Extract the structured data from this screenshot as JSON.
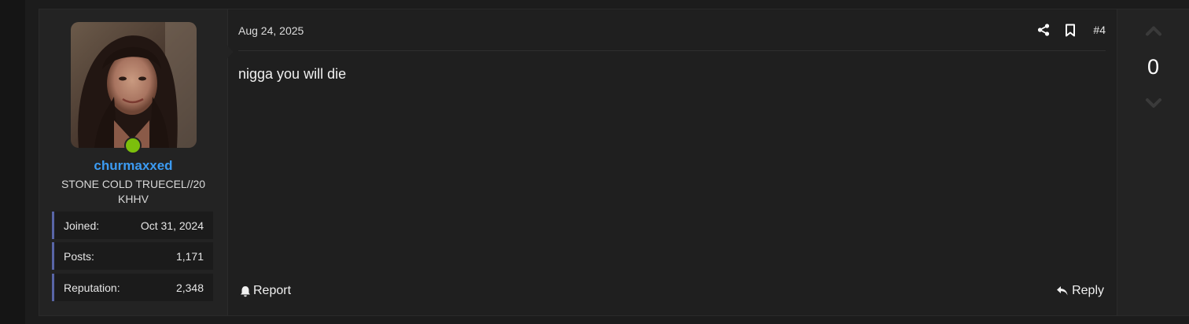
{
  "user": {
    "username": "churmaxxed",
    "title": "STONE COLD TRUECEL//20 KHHV",
    "status_color": "#7cbf0c",
    "username_color": "#3c9bf2",
    "stats": [
      {
        "label": "Joined:",
        "value": "Oct 31, 2024"
      },
      {
        "label": "Posts:",
        "value": "1,171"
      },
      {
        "label": "Reputation:",
        "value": "2,348"
      }
    ]
  },
  "post": {
    "date": "Aug 24, 2025",
    "number": "#4",
    "message": "nigga you will die",
    "actions": {
      "share_icon": "share-icon",
      "bookmark_icon": "bookmark-icon"
    },
    "footer": {
      "report_label": "Report",
      "reply_label": "Reply"
    }
  },
  "votes": {
    "count": "0"
  }
}
